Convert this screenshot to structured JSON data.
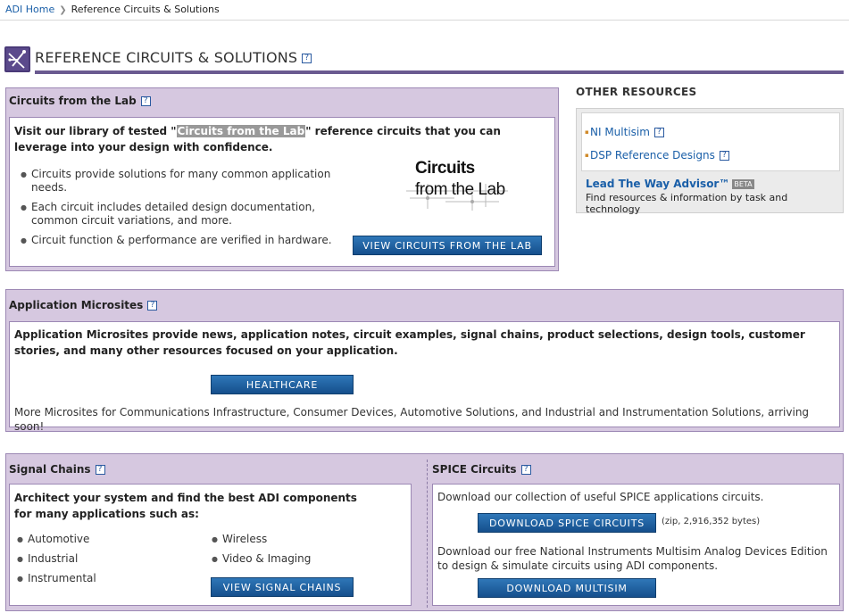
{
  "breadcrumb": {
    "home": "ADI Home",
    "current": "Reference Circuits & Solutions"
  },
  "page": {
    "title": "REFERENCE CIRCUITS & SOLUTIONS",
    "help": "?"
  },
  "cftl": {
    "title": "Circuits from the Lab",
    "intro_pre": "Visit our library of tested \"",
    "intro_hl": "Circuits from the Lab",
    "intro_post": "\" reference circuits that you can leverage into your design with confidence.",
    "bullets": [
      "Circuits provide solutions for many common application needs.",
      "Each circuit includes detailed design documentation, common circuit variations, and more.",
      "Circuit function & performance are verified in hardware."
    ],
    "logo_line1": "Circuits",
    "logo_line2": "from the Lab",
    "button": "VIEW CIRCUITS FROM THE LAB"
  },
  "other": {
    "title": "OTHER RESOURCES",
    "links": [
      "NI Multisim",
      "DSP Reference Designs"
    ],
    "advisor": "Lead The Way Advisor™",
    "beta": "BETA",
    "advisor_sub": "Find resources & information by task and technology"
  },
  "microsites": {
    "title": "Application Microsites",
    "intro": "Application Microsites provide news, application notes, circuit examples, signal chains, product selections, design tools, customer stories, and many other resources focused on your application.",
    "button": "HEALTHCARE",
    "more": "More Microsites for Communications Infrastructure, Consumer Devices, Automotive Solutions, and Industrial and Instrumentation Solutions, arriving soon!"
  },
  "signal": {
    "title": "Signal Chains",
    "intro": "Architect your system and find the best ADI components for many applications such as:",
    "col1": [
      "Automotive",
      "Industrial",
      "Instrumental"
    ],
    "col2": [
      "Wireless",
      "Video & Imaging"
    ],
    "button": "VIEW SIGNAL CHAINS"
  },
  "spice": {
    "title": "SPICE Circuits",
    "intro": "Download our collection of useful SPICE applications circuits.",
    "button": "DOWNLOAD SPICE CIRCUITS",
    "size": "(zip, 2,916,352 bytes)",
    "multisim_text": "Download our free National Instruments Multisim Analog Devices Edition to design & simulate circuits using ADI components.",
    "button2": "DOWNLOAD MULTISIM"
  }
}
